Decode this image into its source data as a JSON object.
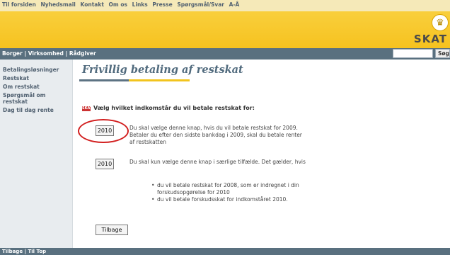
{
  "top_nav": [
    "Til forsiden",
    "Nyhedsmail",
    "Kontakt",
    "Om os",
    "Links",
    "Presse",
    "Spørgsmål/Svar",
    "A-Å"
  ],
  "header": {
    "logo": "SKAT",
    "crown_icon": "crown-icon"
  },
  "sub_nav": {
    "items": [
      "Borger",
      "Virksomhed",
      "Rådgiver"
    ],
    "separator": " | "
  },
  "search": {
    "button_label": "Søg",
    "value": ""
  },
  "sidebar": {
    "items": [
      "Betalingsløsninger",
      "Restskat",
      "Om restskat",
      "Spørgsmål om restskat",
      "Dag til dag rente"
    ]
  },
  "main": {
    "title": "Frivillig betaling af restskat",
    "question": "Vælg hvilket indkomstår du vil betale restskat for:",
    "option1": {
      "label": "2010",
      "text": "Du skal vælge denne knap, hvis du vil betale restskat for 2009. Betaler du efter den sidste bankdag i 2009, skal du betale renter af restskatten"
    },
    "option2": {
      "label": "2010",
      "text": "Du skal kun vælge denne knap i særlige tilfælde. Det gælder, hvis"
    },
    "bullets": [
      "du vil betale restskat for 2008, som er indregnet i din forskudsopgørelse for 2010",
      "du vil betale forskudsskat for indkomståret 2010."
    ],
    "back_label": "Tilbage"
  },
  "footer": "Tilbage | Til Top",
  "colors": {
    "header_yellow": "#f6c21f",
    "nav_slate": "#59707f",
    "title_blue": "#506a7d",
    "highlight_red": "#d21f1f"
  }
}
